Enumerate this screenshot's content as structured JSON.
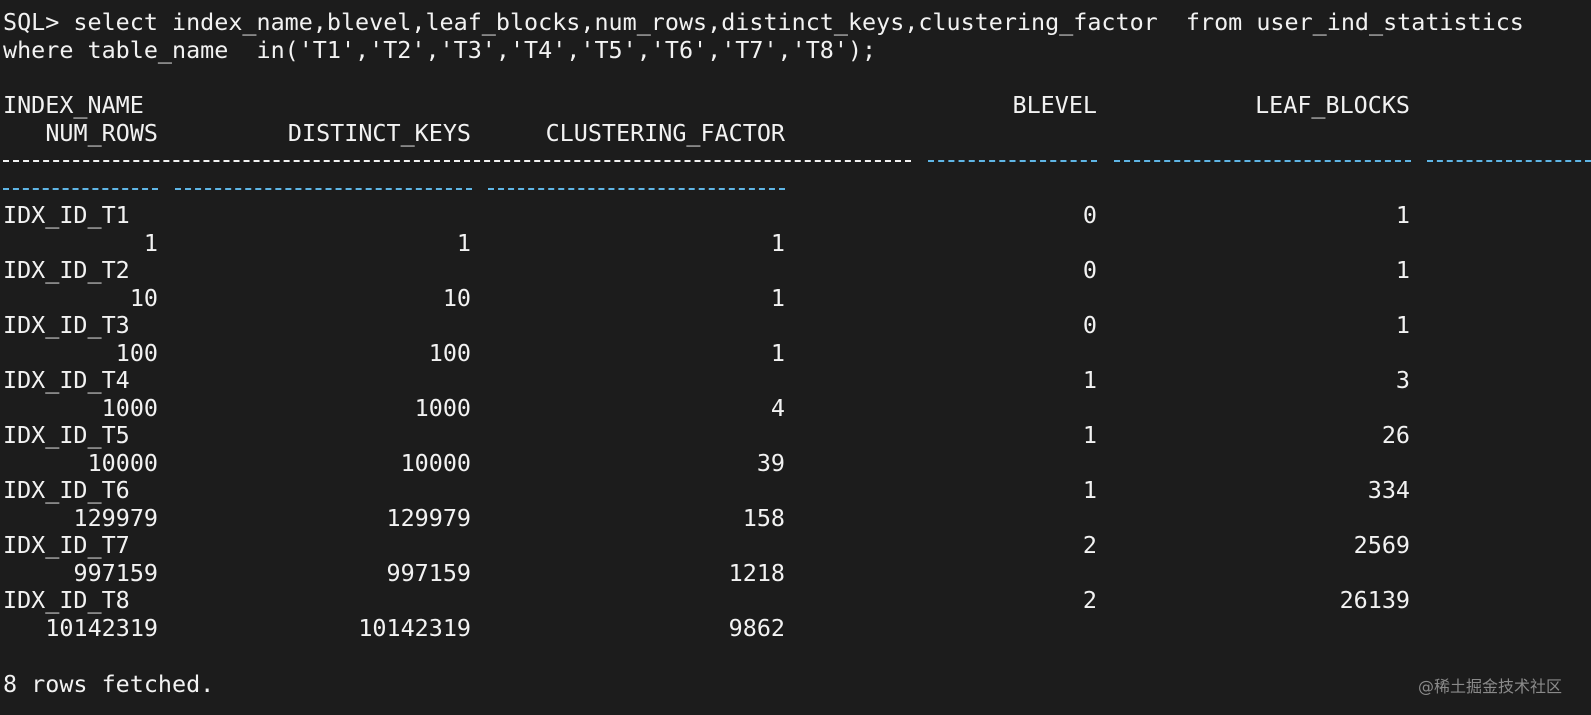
{
  "sql": {
    "line1": "SQL> select index_name,blevel,leaf_blocks,num_rows,distinct_keys,clustering_factor  from user_ind_statistics",
    "line2": "where table_name  in('T1','T2','T3','T4','T5','T6','T7','T8');"
  },
  "headers": {
    "index_name": "INDEX_NAME",
    "blevel": "BLEVEL",
    "leaf_blocks": "LEAF_BLOCKS",
    "num_rows": "NUM_ROWS",
    "distinct_keys": "DISTINCT_KEYS",
    "clustering_factor": "CLUSTERING_FACTOR"
  },
  "rows": [
    {
      "index_name": "IDX_ID_T1",
      "blevel": "0",
      "leaf_blocks": "1",
      "num_rows": "1",
      "distinct_keys": "1",
      "clustering_factor": "1"
    },
    {
      "index_name": "IDX_ID_T2",
      "blevel": "0",
      "leaf_blocks": "1",
      "num_rows": "10",
      "distinct_keys": "10",
      "clustering_factor": "1"
    },
    {
      "index_name": "IDX_ID_T3",
      "blevel": "0",
      "leaf_blocks": "1",
      "num_rows": "100",
      "distinct_keys": "100",
      "clustering_factor": "1"
    },
    {
      "index_name": "IDX_ID_T4",
      "blevel": "1",
      "leaf_blocks": "3",
      "num_rows": "1000",
      "distinct_keys": "1000",
      "clustering_factor": "4"
    },
    {
      "index_name": "IDX_ID_T5",
      "blevel": "1",
      "leaf_blocks": "26",
      "num_rows": "10000",
      "distinct_keys": "10000",
      "clustering_factor": "39"
    },
    {
      "index_name": "IDX_ID_T6",
      "blevel": "1",
      "leaf_blocks": "334",
      "num_rows": "129979",
      "distinct_keys": "129979",
      "clustering_factor": "158"
    },
    {
      "index_name": "IDX_ID_T7",
      "blevel": "2",
      "leaf_blocks": "2569",
      "num_rows": "997159",
      "distinct_keys": "997159",
      "clustering_factor": "1218"
    },
    {
      "index_name": "IDX_ID_T8",
      "blevel": "2",
      "leaf_blocks": "26139",
      "num_rows": "10142319",
      "distinct_keys": "10142319",
      "clustering_factor": "9862"
    }
  ],
  "footer": "8 rows fetched.",
  "watermark": "@稀土掘金技术社区",
  "colors": {
    "background": "#1c1c1c",
    "text": "#f2f2f2",
    "separator_accent": "#5fb6e6"
  }
}
